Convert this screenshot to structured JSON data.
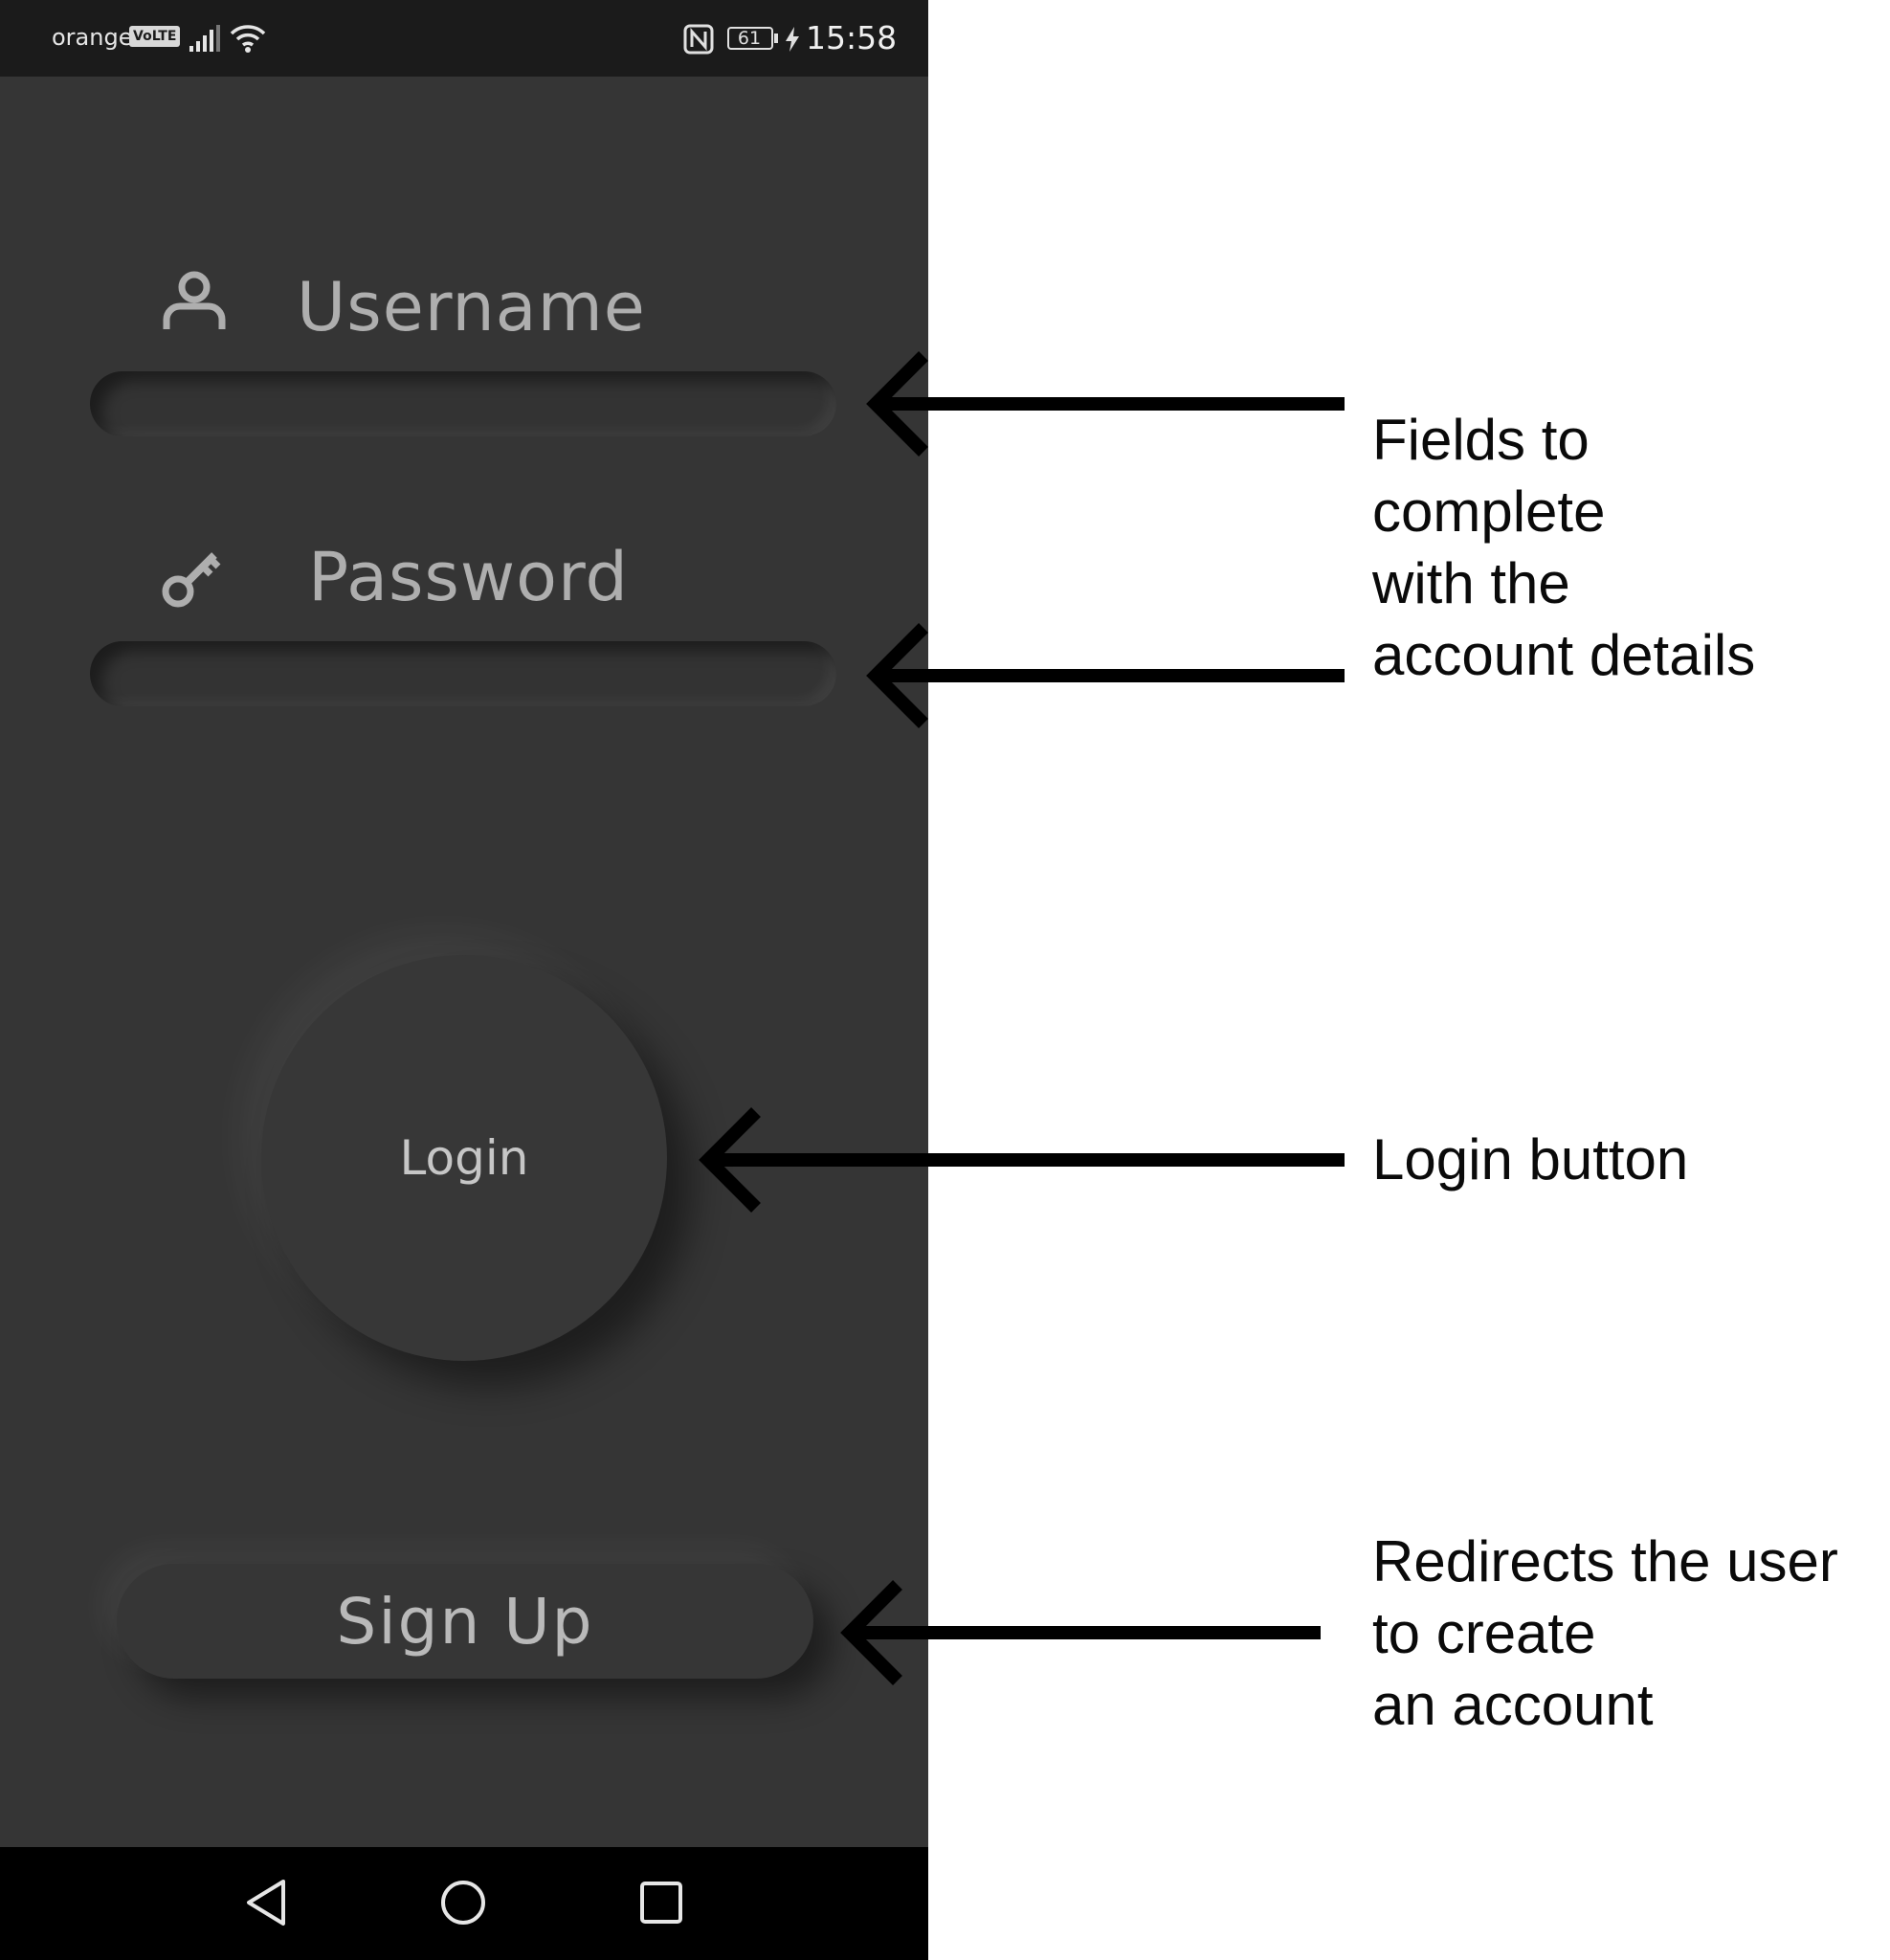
{
  "status_bar": {
    "carrier": "orange",
    "network_badge": "VoLTE",
    "battery_level": "61",
    "time": "15:58",
    "icons": [
      "signal-icon",
      "wifi-icon",
      "nfc-icon",
      "battery-icon",
      "charging-icon"
    ]
  },
  "login_form": {
    "username_label": "Username",
    "password_label": "Password",
    "username_value": "",
    "password_value": "",
    "login_label": "Login",
    "signup_label": "Sign Up",
    "icons": {
      "username": "user-icon",
      "password": "key-icon"
    }
  },
  "nav_bar": {
    "buttons": [
      "back-icon",
      "home-icon",
      "recents-icon"
    ]
  },
  "annotations": {
    "fields": [
      "Fields to",
      "complete",
      "with the",
      "account details"
    ],
    "login": [
      "Login button"
    ],
    "signup": [
      "Redirects the user",
      "to create",
      "an account"
    ]
  },
  "colors": {
    "app_background": "#353535",
    "status_bar": "#1b1b1b",
    "nav_bar": "#000000",
    "label_text": "#aeaeae",
    "annotation_text": "#0a0a0a"
  }
}
